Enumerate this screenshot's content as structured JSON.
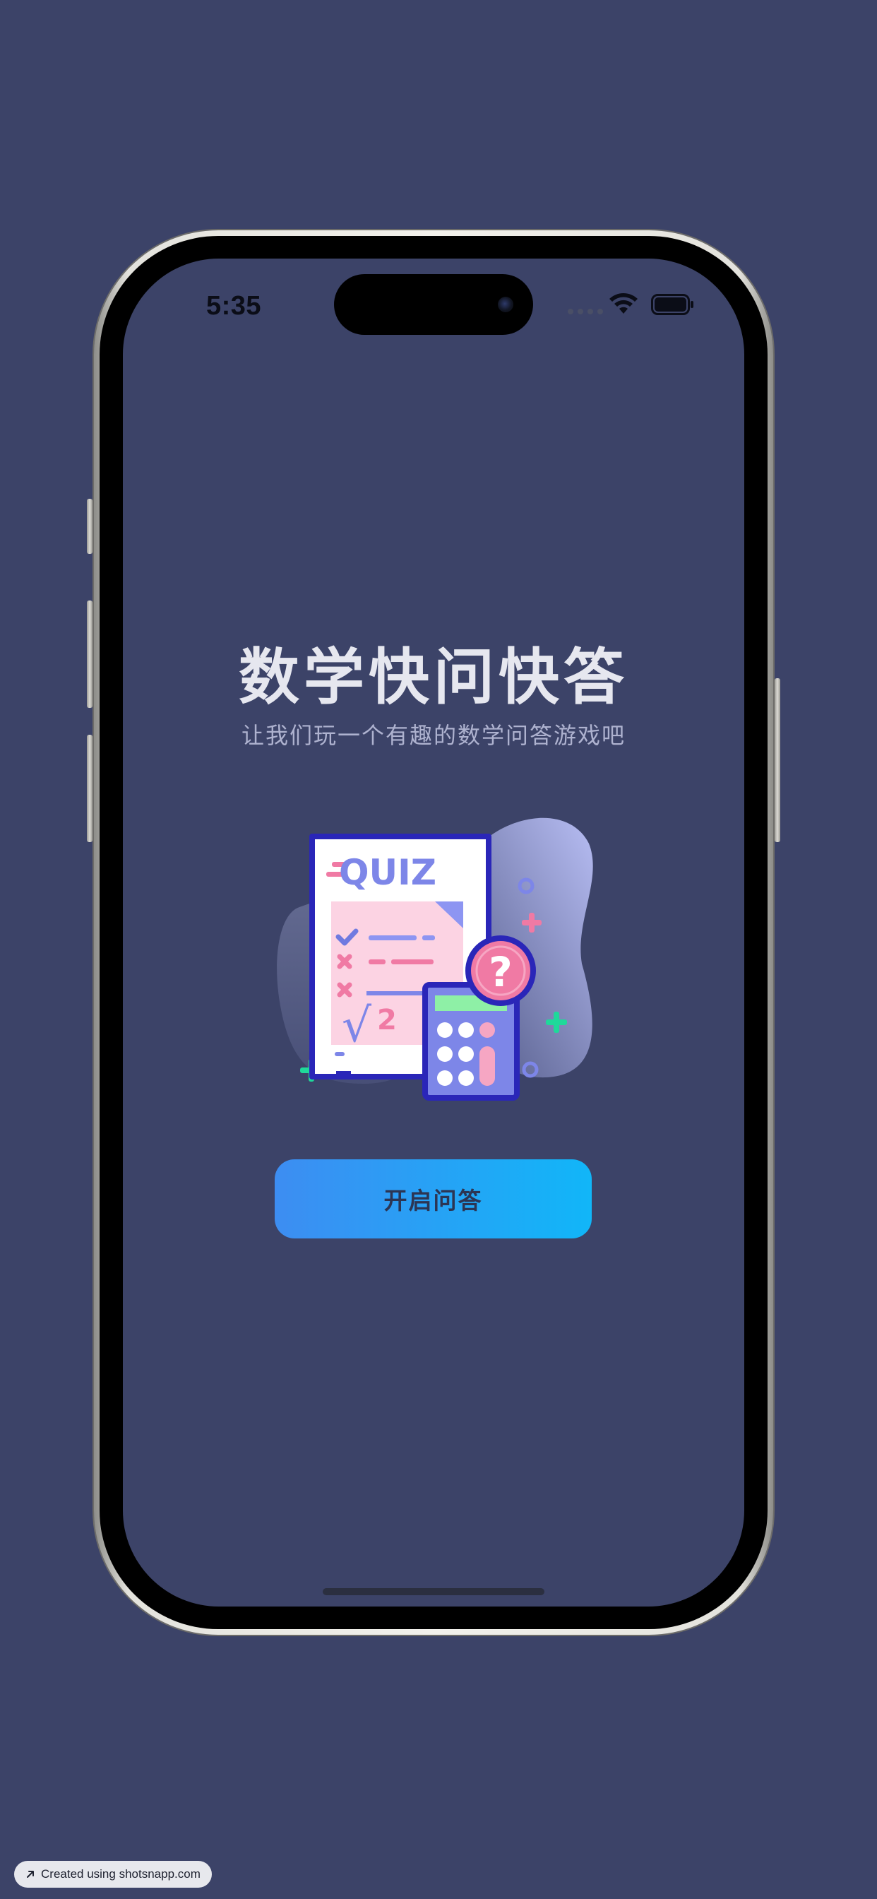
{
  "status_bar": {
    "time": "5:35"
  },
  "main": {
    "title": "数学快问快答",
    "subtitle": "让我们玩一个有趣的数学问答游戏吧",
    "illustration": {
      "quiz_label": "QUIZ",
      "question_mark": "?",
      "sqrt_symbol": "√",
      "exponent": "2"
    },
    "start_button_label": "开启问答"
  },
  "watermark": {
    "text": "Created using shotsnapp.com",
    "icon": "arrow-up-right-icon"
  },
  "colors": {
    "background": "#3c4368",
    "button_gradient_start": "#3d8df2",
    "button_gradient_end": "#11b6f8",
    "title": "#e6e7ef",
    "subtitle": "#aeb2cf"
  }
}
